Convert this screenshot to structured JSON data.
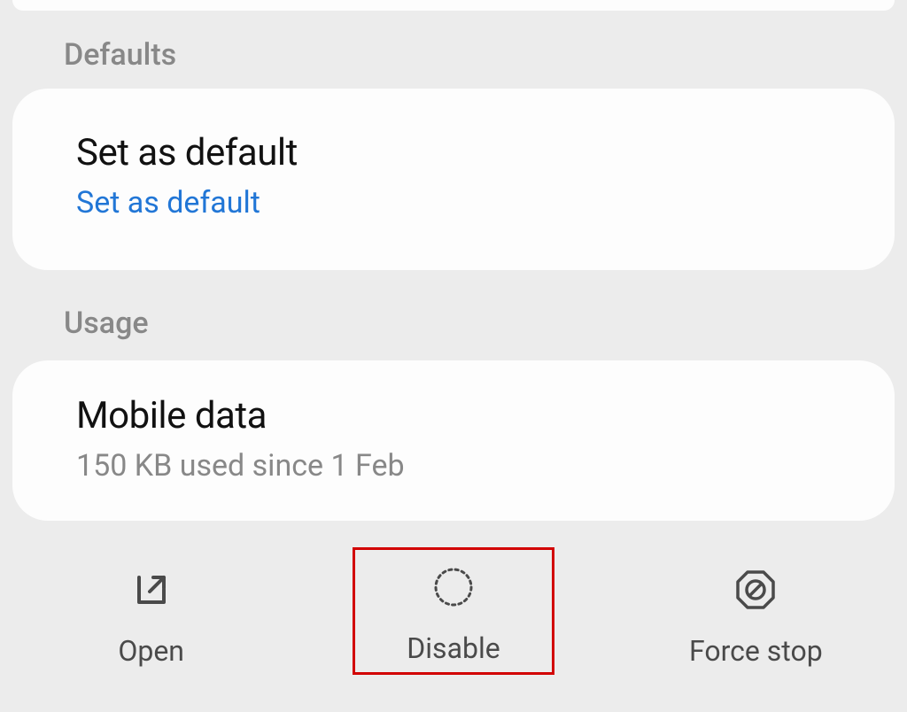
{
  "sections": {
    "defaults": {
      "header": "Defaults",
      "item": {
        "title": "Set as default",
        "subtitle": "Set as default"
      }
    },
    "usage": {
      "header": "Usage",
      "item": {
        "title": "Mobile data",
        "subtitle": "150 KB used since 1 Feb"
      }
    }
  },
  "bottomBar": {
    "open": "Open",
    "disable": "Disable",
    "forceStop": "Force stop"
  }
}
